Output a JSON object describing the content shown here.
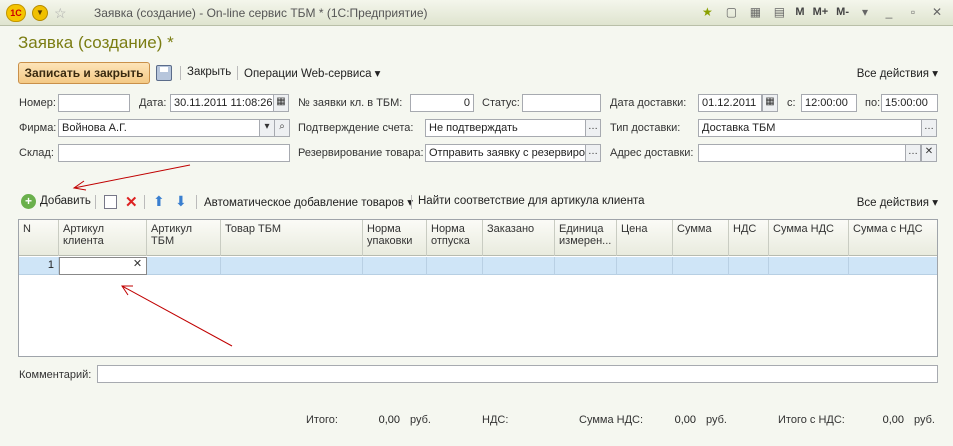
{
  "window": {
    "title": "Заявка (создание) - On-line сервис ТБМ * (1С:Предприятие)",
    "logo": "1С",
    "right_letters": [
      "M",
      "M+",
      "M-"
    ]
  },
  "doc_title": "Заявка (создание) *",
  "toolbar": {
    "save_close": "Записать и закрыть",
    "close": "Закрыть",
    "web_ops": "Операции Web-сервиса ▾",
    "all_actions": "Все действия ▾"
  },
  "form": {
    "number_label": "Номер:",
    "number_value": "",
    "date_label": "Дата:",
    "date_value": "30.11.2011 11:08:26",
    "client_no_label": "№ заявки кл. в ТБМ:",
    "client_no_value": "0",
    "status_label": "Статус:",
    "status_value": "",
    "delivery_date_label": "Дата доставки:",
    "delivery_date_value": "01.12.2011",
    "from_label": "с:",
    "from_value": "12:00:00",
    "to_label": "по:",
    "to_value": "15:00:00",
    "firm_label": "Фирма:",
    "firm_value": "Войнова А.Г.",
    "confirm_label": "Подтверждение счета:",
    "confirm_value": "Не подтверждать",
    "delivery_type_label": "Тип доставки:",
    "delivery_type_value": "Доставка ТБМ",
    "warehouse_label": "Склад:",
    "warehouse_value": "",
    "reserve_label": "Резервирование товара:",
    "reserve_value": "Отправить заявку с резервиро",
    "address_label": "Адрес доставки:",
    "address_value": ""
  },
  "table_toolbar": {
    "add": "Добавить",
    "auto_add": "Автоматическое добавление товаров ▾",
    "find_match": "Найти соответствие для артикула клиента",
    "all_actions": "Все действия ▾"
  },
  "table": {
    "columns": [
      "N",
      "Артикул\nклиента",
      "Артикул\nТБМ",
      "Товар ТБМ",
      "Норма\nупаковки",
      "Норма\nотпуска",
      "Заказано",
      "Единица\nизмерен...",
      "Цена",
      "Сумма",
      "НДС",
      "Сумма НДС",
      "Сумма с НДС"
    ],
    "rows": [
      {
        "n": "1"
      }
    ]
  },
  "comment_label": "Комментарий:",
  "comment_value": "",
  "totals": {
    "total_label": "Итого:",
    "total_value": "0,00",
    "total_cur": "руб.",
    "vat_label": "НДС:",
    "vat_sum_label": "Сумма НДС:",
    "vat_sum_value": "0,00",
    "vat_sum_cur": "руб.",
    "total_vat_label": "Итого с НДС:",
    "total_vat_value": "0,00",
    "total_vat_cur": "руб."
  },
  "colors": {
    "title_olive": "#7b7d13",
    "arrow_red": "#c00000",
    "row_selected": "#cfe5f7"
  }
}
